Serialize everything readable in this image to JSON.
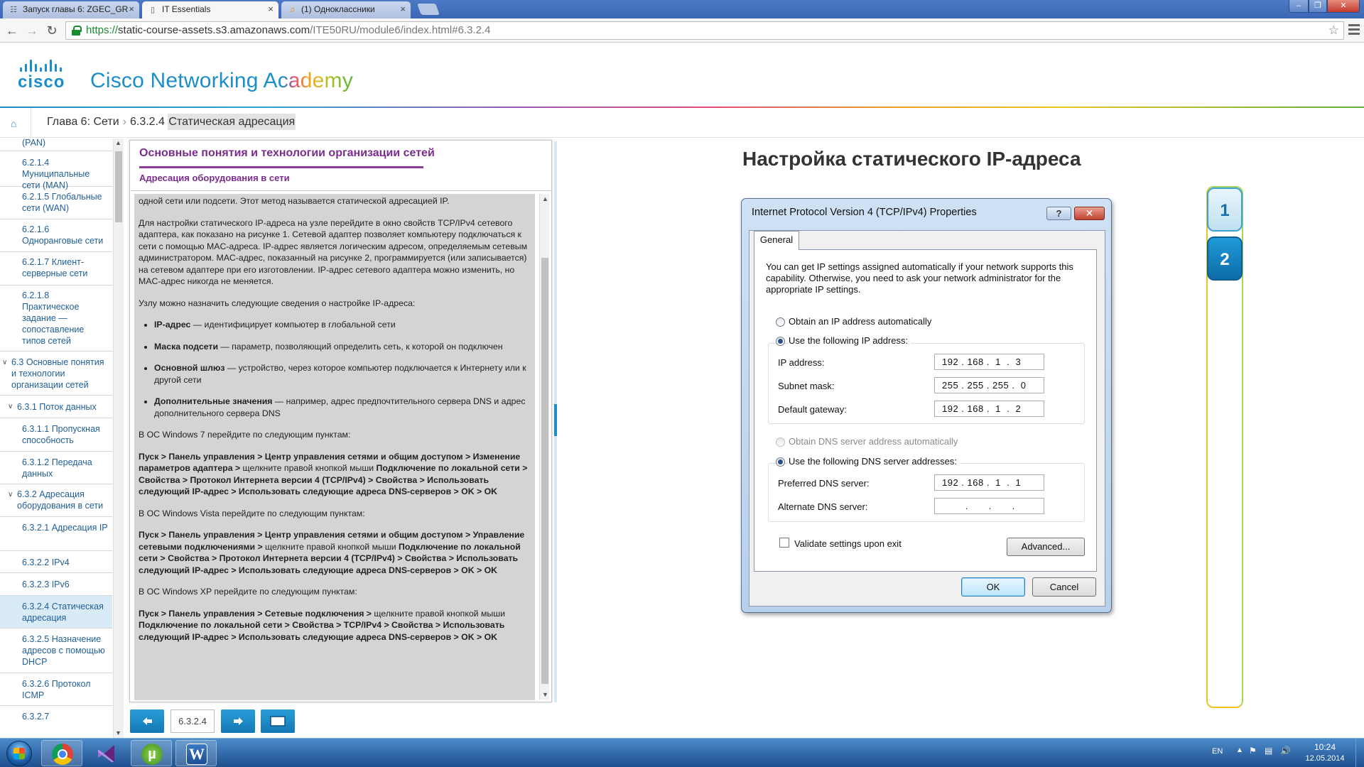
{
  "browser": {
    "tabs": [
      {
        "title": "Запуск главы 6: ZGEC_GR",
        "icon": "sitemap-icon",
        "active": false
      },
      {
        "title": "IT Essentials",
        "icon": "page-icon",
        "active": true
      },
      {
        "title": "(1) Одноклассники",
        "icon": "ok-icon",
        "active": false
      }
    ],
    "address": {
      "scheme": "https://",
      "host": "static-course-assets.s3.amazonaws.com",
      "path": "/ITE50RU/module6/index.html#6.3.2.4"
    }
  },
  "header": {
    "logo_text": "cisco",
    "brand_part1": "Cisco Networ",
    "brand_part2": "king Academy"
  },
  "breadcrumb": {
    "chapter": "Глава 6: Сети",
    "section_num": "6.3.2.4",
    "section_title": "Статическая адресация",
    "separator": "›"
  },
  "sidebar": {
    "items": [
      {
        "label": "(PAN)"
      },
      {
        "label": "6.2.1.4 Муниципальные сети (MAN)"
      },
      {
        "label": "6.2.1.5 Глобальные сети (WAN)"
      },
      {
        "label": "6.2.1.6 Одноранговые сети"
      },
      {
        "label": "6.2.1.7 Клиент-серверные сети"
      },
      {
        "label": "6.2.1.8 Практическое задание — сопоставление типов сетей"
      },
      {
        "label": "6.3 Основные понятия и технологии организации сетей"
      },
      {
        "label": "6.3.1 Поток данных"
      },
      {
        "label": "6.3.1.1 Пропускная способность"
      },
      {
        "label": "6.3.1.2 Передача данных"
      },
      {
        "label": "6.3.2 Адресация оборудования в сети"
      },
      {
        "label": "6.3.2.1 Адресация IP"
      },
      {
        "label": "6.3.2.2 IPv4"
      },
      {
        "label": "6.3.2.3 IPv6"
      },
      {
        "label": "6.3.2.4 Статическая адресация"
      },
      {
        "label": "6.3.2.5 Назначение адресов с помощью DHCP"
      },
      {
        "label": "6.3.2.6 Протокол ICMP"
      },
      {
        "label": "6.3.2.7"
      }
    ]
  },
  "content": {
    "title": "Основные понятия и технологии организации сетей",
    "subtitle": "Адресация оборудования в сети",
    "p0": "одной сети или подсети. Этот метод называется статической адресацией IP.",
    "p1": "Для настройки статического IP-адреса на узле перейдите в окно свойств TCP/IPv4 сетевого адаптера, как показано на рисунке 1. Сетевой адаптер позволяет компьютеру подключаться к сети с помощью MAC-адреса. IP-адрес является логическим адресом, определяемым сетевым администратором. MAC-адрес, показанный на рисунке 2, программируется (или записывается) на сетевом адаптере при его изготовлении. IP-адрес сетевого адаптера можно изменить, но MAC-адрес никогда не меняется.",
    "p2": "Узлу можно назначить следующие сведения о настройке IP-адреса:",
    "li": [
      {
        "b": "IP-адрес",
        "t": " — идентифицирует компьютер в глобальной сети"
      },
      {
        "b": "Маска подсети",
        "t": " — параметр, позволяющий определить сеть, к которой он подключен"
      },
      {
        "b": "Основной шлюз",
        "t": " — устройство, через которое компьютер подключается к Интернету или к другой сети"
      },
      {
        "b": "Дополнительные значения",
        "t": " — например, адрес предпочтительного сервера DNS и адрес дополнительного сервера DNS"
      }
    ],
    "w7_intro": "В ОС Windows 7 перейдите по следующим пунктам:",
    "w7_a": "Пуск > Панель управления > Центр управления сетями и общим доступом > Изменение параметров адаптера >",
    "w7_b": " щелкните правой кнопкой мыши ",
    "w7_c": "Подключение по локальной сети > Свойства > Протокол Интернета версии 4 (TCP/IPv4) > Свойства > Использовать следующий IP-адрес > Использовать следующие адреса DNS-серверов > OK > OK",
    "vista_intro": "В ОС Windows Vista перейдите по следующим пунктам:",
    "vista_a": "Пуск > Панель управления > Центр управления сетями и общим доступом > Управление сетевыми подключениями >",
    "vista_b": " щелкните правой кнопкой мыши ",
    "vista_c": "Подключение по локальной сети > Свойства > Протокол Интернета версии 4 (TCP/IPv4) > Свойства > Использовать следующий IP-адрес > Использовать следующие адреса DNS-серверов > OK > OK",
    "xp_intro": "В ОС Windows XP перейдите по следующим пунктам:",
    "xp_a": "Пуск > Панель управления > Сетевые подключения >",
    "xp_b": " щелкните правой кнопкой мыши ",
    "xp_c": "Подключение по локальной сети > Свойства > TCP/IPv4 > Свойства > Использовать следующий IP-адрес > Использовать следующие адреса DNS-серверов > OK > OK"
  },
  "bottom_nav": {
    "page_label": "6.3.2.4"
  },
  "figure": {
    "title": "Настройка статического IP-адреса",
    "buttons": [
      "1",
      "2"
    ],
    "dialog": {
      "title": "Internet Protocol Version 4 (TCP/IPv4) Properties",
      "help": "?",
      "tab": "General",
      "description": "You can get IP settings assigned automatically if your network supports this capability. Otherwise, you need to ask your network administrator for the appropriate IP settings.",
      "radio_auto_ip": "Obtain an IP address automatically",
      "radio_static_ip": "Use the following IP address:",
      "ip_label": "IP address:",
      "ip_value": "192 . 168 .  1  .  3",
      "mask_label": "Subnet mask:",
      "mask_value": "255 . 255 . 255 .  0",
      "gw_label": "Default gateway:",
      "gw_value": "192 . 168 .  1  .  2",
      "radio_auto_dns": "Obtain DNS server address automatically",
      "radio_static_dns": "Use the following DNS server addresses:",
      "pdns_label": "Preferred DNS server:",
      "pdns_value": "192 . 168 .  1  .  1",
      "adns_label": "Alternate DNS server:",
      "adns_value": "        .       .       .",
      "validate": "Validate settings upon exit",
      "advanced": "Advanced...",
      "ok": "OK",
      "cancel": "Cancel"
    }
  },
  "taskbar": {
    "lang": "EN",
    "time": "10:24",
    "date": "12.05.2014"
  },
  "colors": {
    "cisco_blue": "#1b8ec9",
    "section_purple": "#7b2d8e"
  }
}
